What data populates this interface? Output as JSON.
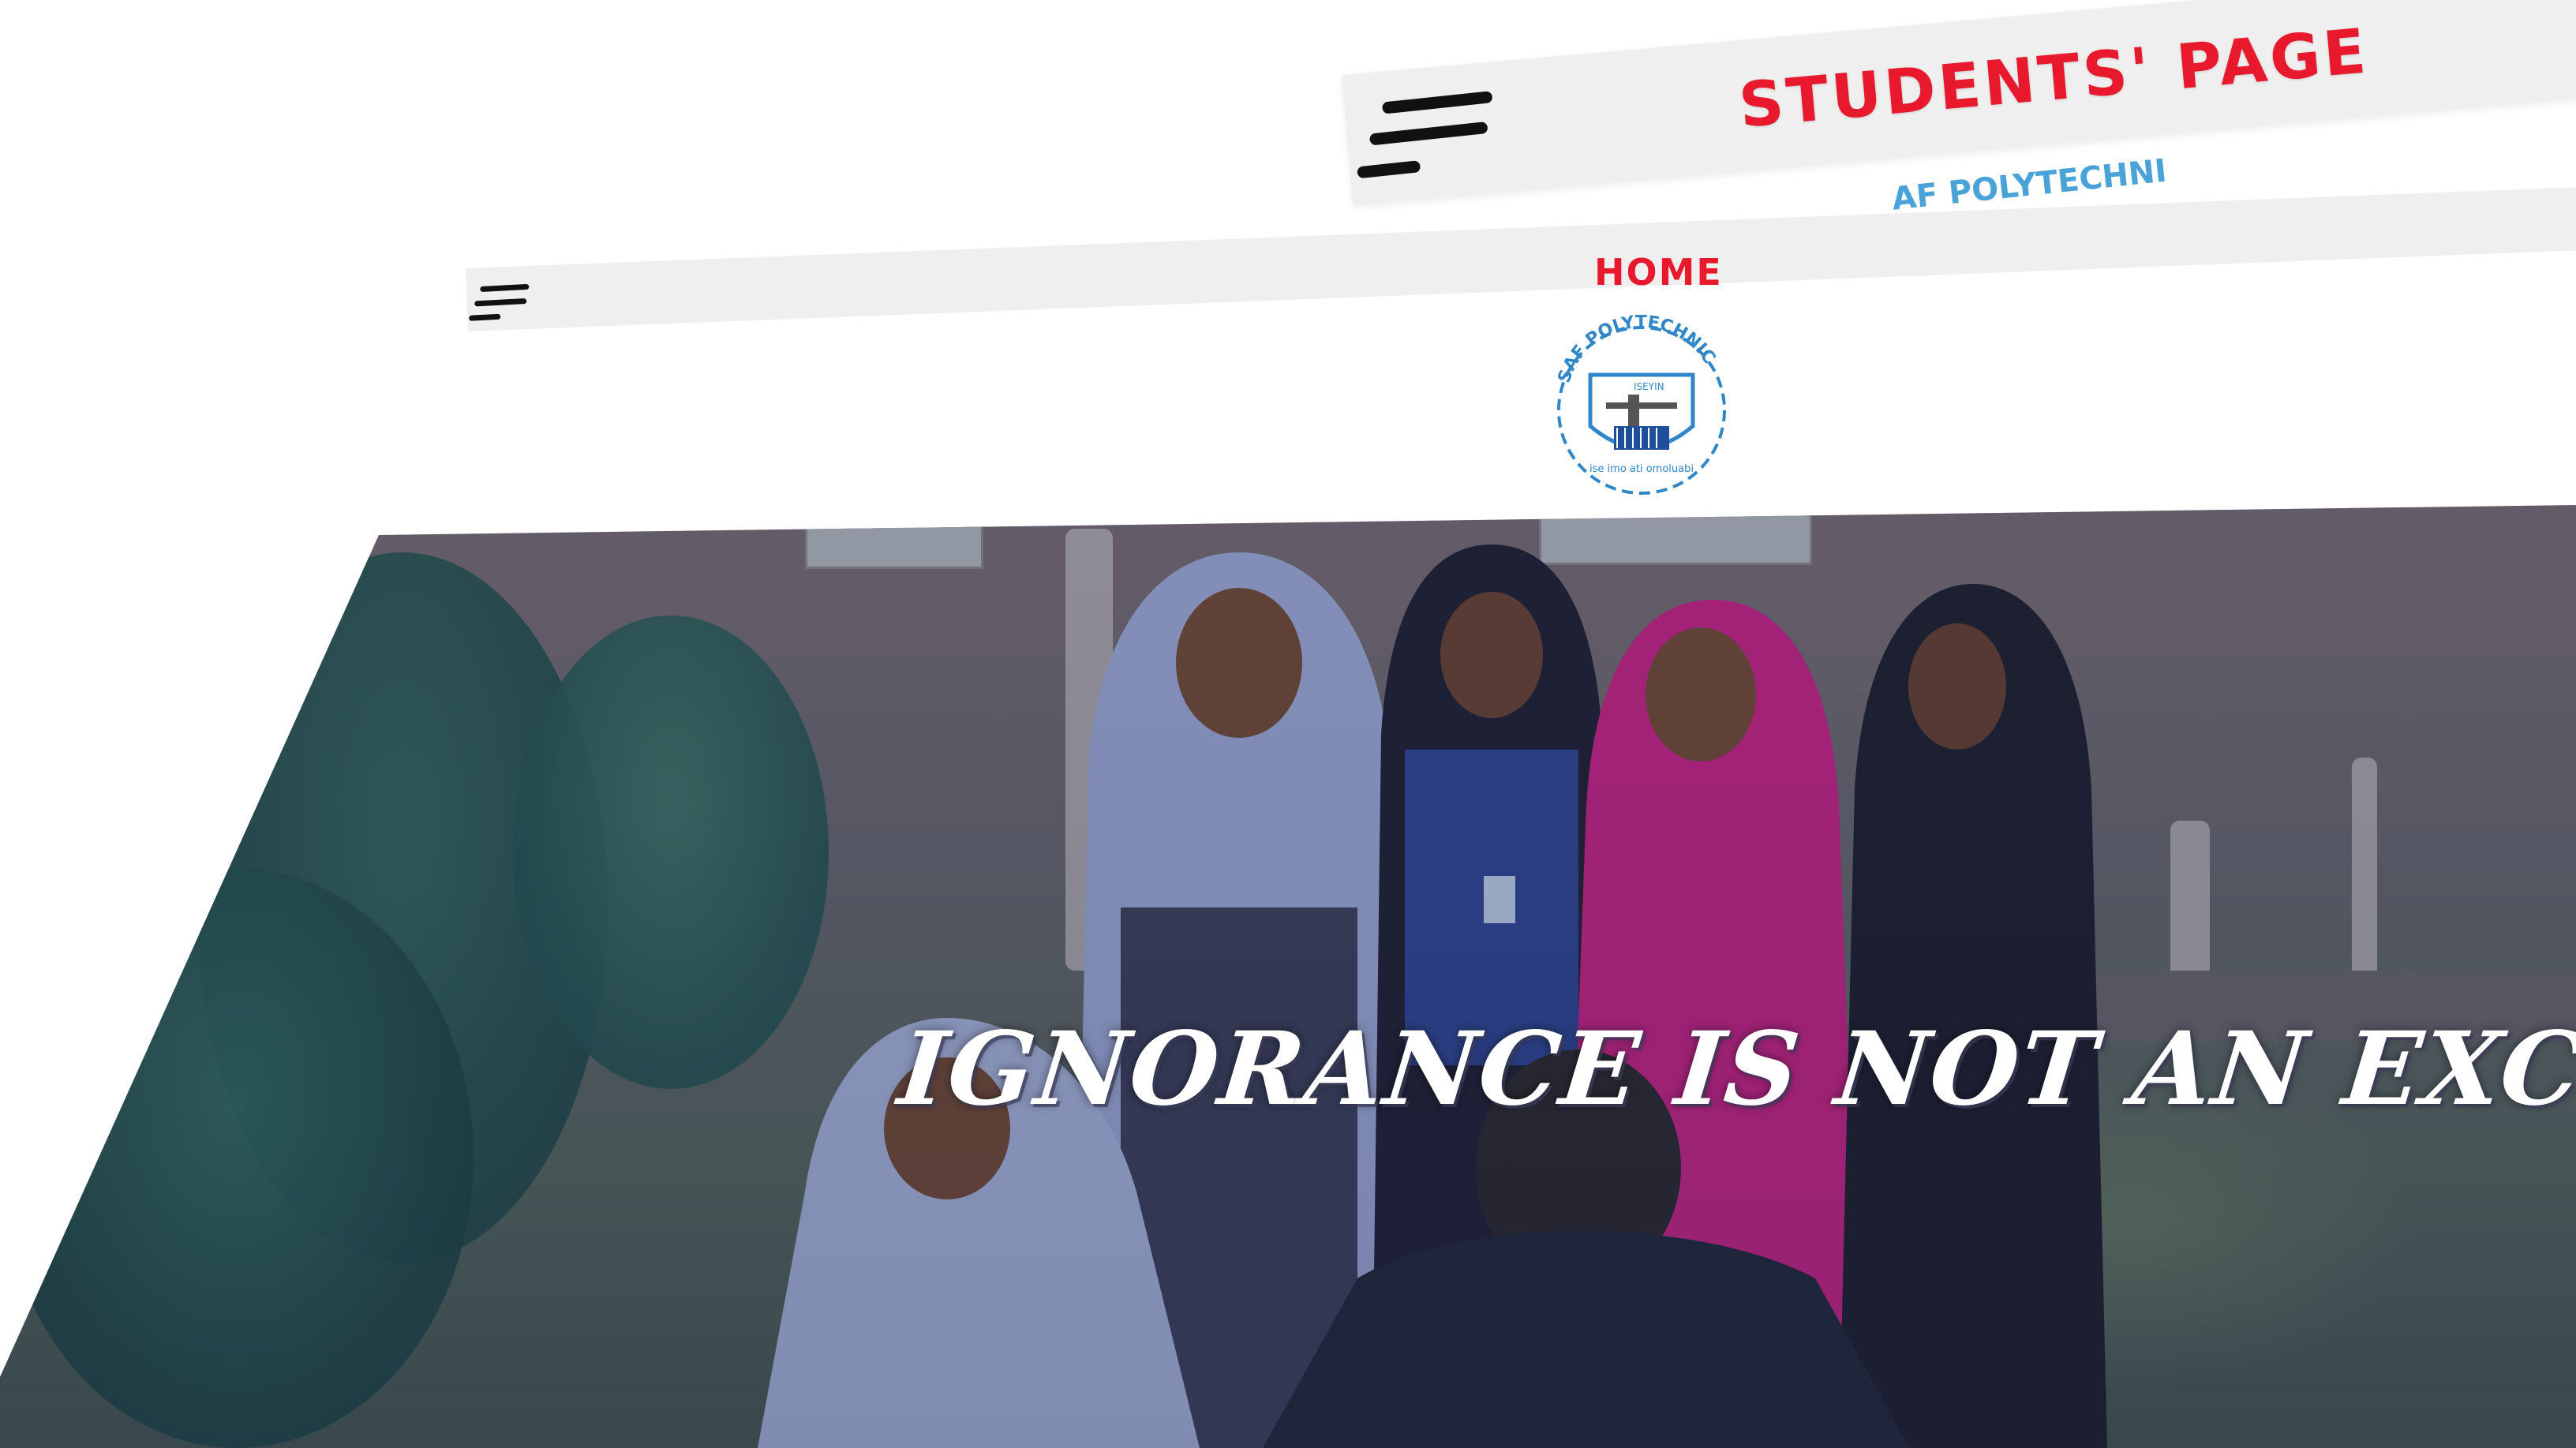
{
  "back_page": {
    "title": "STUDENTS' PAGE",
    "logo_arc_text": "AF POLYTECHNI"
  },
  "nav": {
    "home_label": "HOME"
  },
  "logo": {
    "arc_text": "SAF POLYTECHNIC",
    "city": "ISEYIN",
    "motto": "ise imo ati omoluabi"
  },
  "hero": {
    "tagline": "IGNORANCE IS NOT AN EXCUSE!!"
  },
  "colors": {
    "accent_red": "#e8192c",
    "logo_blue": "#2f86c9",
    "nav_bg": "#efefef"
  },
  "icons": [
    "hamburger-menu-icon",
    "school-logo"
  ]
}
